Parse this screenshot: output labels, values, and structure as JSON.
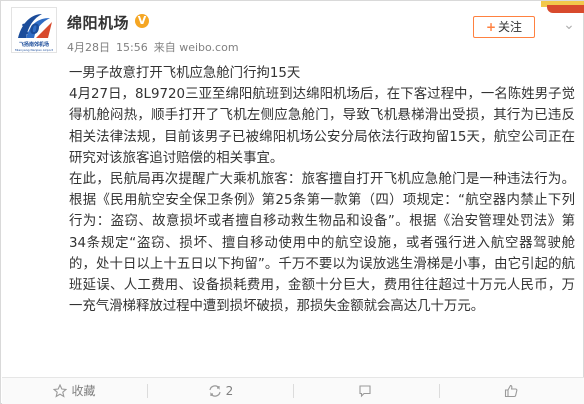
{
  "account": {
    "name": "绵阳机场",
    "verified_badge": "V",
    "avatar_text": "飞扬南郊机场",
    "avatar_subtext": "Mianyang Nanjiao Airport",
    "accent_color": "#1b4c9a"
  },
  "meta": {
    "date": "4月28日",
    "time": "15:56",
    "source": "来自 weibo.com"
  },
  "follow_button": {
    "plus": "+",
    "label": "关注"
  },
  "more_icon": "chevron-down-icon",
  "post": {
    "title": "一男子故意打开飞机应急舱门行拘15天",
    "paragraph1": "4月27日，8L9720三亚至绵阳航班到达绵阳机场后，在下客过程中，一名陈姓男子觉得机舱闷热，顺手打开了飞机左侧应急舱门，导致飞机悬梯滑出受损，其行为已违反相关法律法规，目前该男子已被绵阳机场公安分局依法行政拘留15天，航空公司正在研究对该旅客追讨赔偿的相关事宜。",
    "paragraph2": "在此，民航局再次提醒广大乘机旅客：旅客擅自打开飞机应急舱门是一种违法行为。根据《民用航空安全保卫条例》第25条第一款第（四）项规定：“航空器内禁止下列行为：盗窃、故意损坏或者擅自移动救生物品和设备”。根据《治安管理处罚法》第34条规定“盗窃、损坏、擅自移动使用中的航空设施，或者强行进入航空器驾驶舱的，处十日以上十五日以下拘留”。千万不要以为误放逃生滑梯是小事，由它引起的航班延误、人工费用、设备损耗费用，金额十分巨大，费用往往超过十万元人民币，万一充气滑梯释放过程中遭到损坏破损，那损失金额就会高达几十万元。"
  },
  "actions": {
    "favorite": "收藏",
    "repost": "2",
    "comment": "",
    "like": ""
  }
}
